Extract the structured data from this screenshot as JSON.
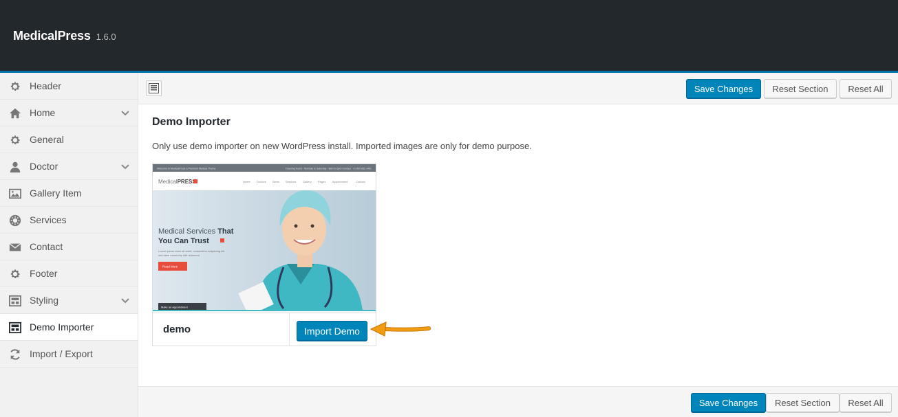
{
  "app": {
    "title": "MedicalPress",
    "version": "1.6.0"
  },
  "sidebar": {
    "items": [
      {
        "label": "Header",
        "icon": "gear-icon",
        "has_chevron": false
      },
      {
        "label": "Home",
        "icon": "home-icon",
        "has_chevron": true
      },
      {
        "label": "General",
        "icon": "gear-icon",
        "has_chevron": false
      },
      {
        "label": "Doctor",
        "icon": "user-icon",
        "has_chevron": true
      },
      {
        "label": "Gallery Item",
        "icon": "image-icon",
        "has_chevron": false
      },
      {
        "label": "Services",
        "icon": "cog-icon",
        "has_chevron": false
      },
      {
        "label": "Contact",
        "icon": "envelope-icon",
        "has_chevron": false
      },
      {
        "label": "Footer",
        "icon": "gear-icon",
        "has_chevron": false
      },
      {
        "label": "Styling",
        "icon": "layout-icon",
        "has_chevron": true
      },
      {
        "label": "Demo Importer",
        "icon": "layout-icon",
        "has_chevron": false,
        "active": true
      },
      {
        "label": "Import / Export",
        "icon": "refresh-icon",
        "has_chevron": false
      }
    ]
  },
  "toolbar": {
    "save_label": "Save Changes",
    "reset_section_label": "Reset Section",
    "reset_all_label": "Reset All"
  },
  "bottom": {
    "save_label": "Save Changes",
    "reset_section_label": "Reset Section",
    "reset_all_label": "Reset All"
  },
  "section": {
    "title": "Demo Importer",
    "description": "Only use demo importer on new WordPress install. Imported images are only for demo purpose."
  },
  "demo": {
    "name": "demo",
    "import_label": "Import Demo",
    "preview": {
      "topbar_left": "Welcome to MedicalPress a Premium Medical Theme",
      "topbar_right": "Opening Hours : Monday to Saturday - 8am to 5pm   Contact : +1 800 652 3461",
      "logo_a": "Medical",
      "logo_b": "PRESS",
      "nav": [
        "Home",
        "Doctors",
        "News",
        "Services",
        "Gallery",
        "Pages",
        "Appointment",
        "Contact"
      ],
      "headline_1a": "Medical Services ",
      "headline_1b": "That",
      "headline_2": "You Can Trust",
      "body_1": "Lorem ipsum dolor sit amet, consectetur adipiscing elit",
      "body_2": "sed diam nonummy nibh euismod",
      "read_more": "Read More",
      "appointment": "Make an Appointment"
    }
  },
  "colors": {
    "primary": "#0085ba",
    "header": "#23282d",
    "accent_line": "#0073aa",
    "arrow": "#f39c12",
    "preview_red": "#e74c3c"
  }
}
